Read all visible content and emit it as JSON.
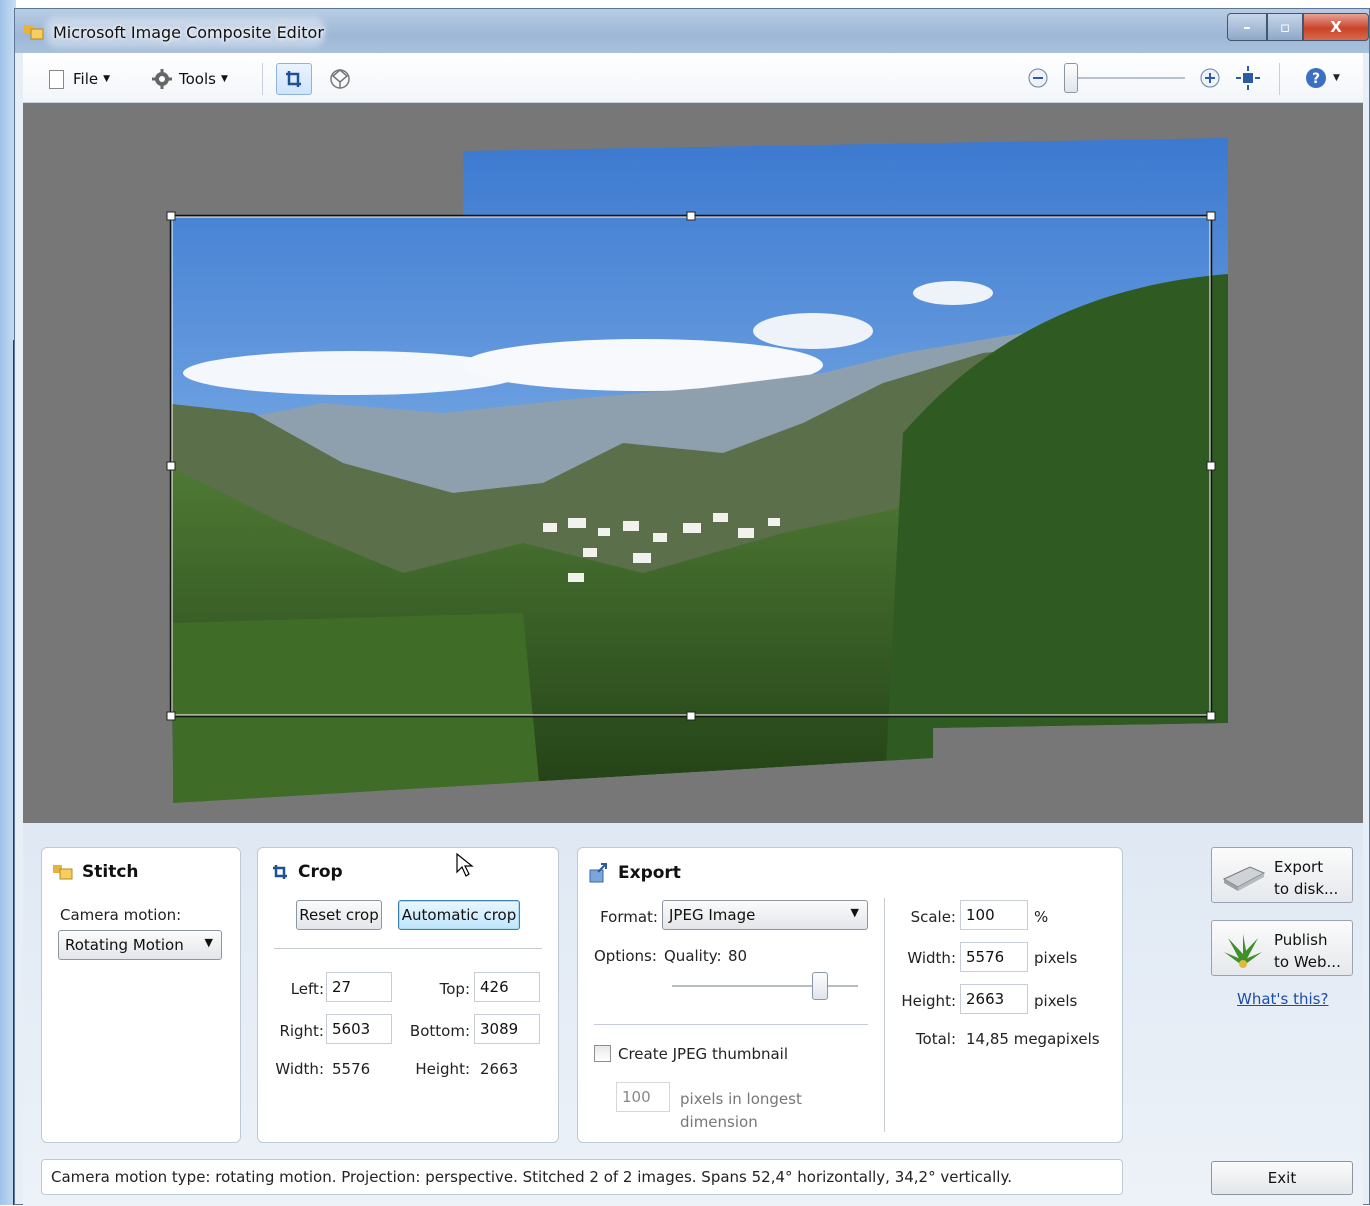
{
  "window": {
    "title": "Microsoft Image Composite Editor",
    "min": "–",
    "max": "▫",
    "close": "X"
  },
  "toolbar": {
    "file": "File",
    "tools": "Tools"
  },
  "stitch": {
    "title": "Stitch",
    "camera_motion_label": "Camera motion:",
    "camera_motion_value": "Rotating Motion"
  },
  "crop": {
    "title": "Crop",
    "reset": "Reset crop",
    "automatic": "Automatic crop",
    "left_label": "Left:",
    "left": "27",
    "top_label": "Top:",
    "top": "426",
    "right_label": "Right:",
    "right": "5603",
    "bottom_label": "Bottom:",
    "bottom": "3089",
    "width_label": "Width:",
    "width": "5576",
    "height_label": "Height:",
    "height": "2663"
  },
  "export": {
    "title": "Export",
    "format_label": "Format:",
    "format_value": "JPEG Image",
    "options_label": "Options:",
    "quality_label": "Quality:",
    "quality": "80",
    "quality_slider_fraction": 0.8,
    "thumbnail_label": "Create JPEG thumbnail",
    "thumbnail_checked": false,
    "thumb_size": "100",
    "thumb_unit_1": "pixels in longest",
    "thumb_unit_2": "dimension",
    "scale_label": "Scale:",
    "scale": "100",
    "scale_unit": "%",
    "width_label": "Width:",
    "width": "5576",
    "width_unit": "pixels",
    "height_label": "Height:",
    "height": "2663",
    "height_unit": "pixels",
    "total_label": "Total:",
    "total": "14,85 megapixels"
  },
  "actions": {
    "export_line1": "Export",
    "export_line2": "to disk...",
    "publish_line1": "Publish",
    "publish_line2": "to Web...",
    "whats_this": "What's this?",
    "exit": "Exit"
  },
  "status": "Camera motion type: rotating motion. Projection: perspective. Stitched 2 of 2 images. Spans 52,4° horizontally, 34,2° vertically.",
  "colors": {
    "accent": "#1a4fa8",
    "canvas": "#777777",
    "panel_bg": "#e8eef6"
  }
}
